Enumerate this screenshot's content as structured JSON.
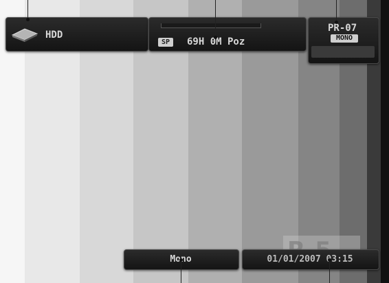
{
  "colors": {
    "panel_bg": "#1f1f1f",
    "text": "#d8d8d8"
  },
  "test_pattern": {
    "bar_colors": [
      "#f6f6f6",
      "#e8e8e8",
      "#d8d8d8",
      "#c6c6c6",
      "#b0b0b0",
      "#9a9a9a",
      "#858585",
      "#6d6d6d",
      "#3a3a3a",
      "#111111"
    ]
  },
  "media_panel": {
    "icon": "hdd-disk-icon",
    "label": "HDD"
  },
  "record_panel": {
    "mode_badge": "SP",
    "remaining": "69H 0M Poz",
    "progress": 0
  },
  "channel_panel": {
    "channel": "PR-07",
    "audio_badge": "MONO"
  },
  "audio_status": "Mono",
  "datetime": "01/01/2007 03:15",
  "watermark": "R-5"
}
